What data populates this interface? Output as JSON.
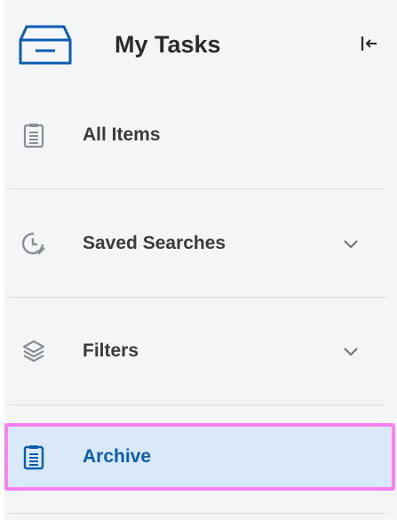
{
  "header": {
    "title": "My Tasks"
  },
  "nav": {
    "items": [
      {
        "label": "All Items",
        "icon": "clipboard-icon"
      },
      {
        "label": "Saved Searches",
        "icon": "clock-check-icon",
        "expandable": true
      },
      {
        "label": "Filters",
        "icon": "layers-icon",
        "expandable": true
      },
      {
        "label": "Archive",
        "icon": "clipboard-icon",
        "active": true
      }
    ]
  },
  "colors": {
    "accent": "#0b5cb0",
    "active_bg": "#d9e9fa",
    "highlight_border": "#ff80ee",
    "panel_bg": "#f4f5f7"
  }
}
